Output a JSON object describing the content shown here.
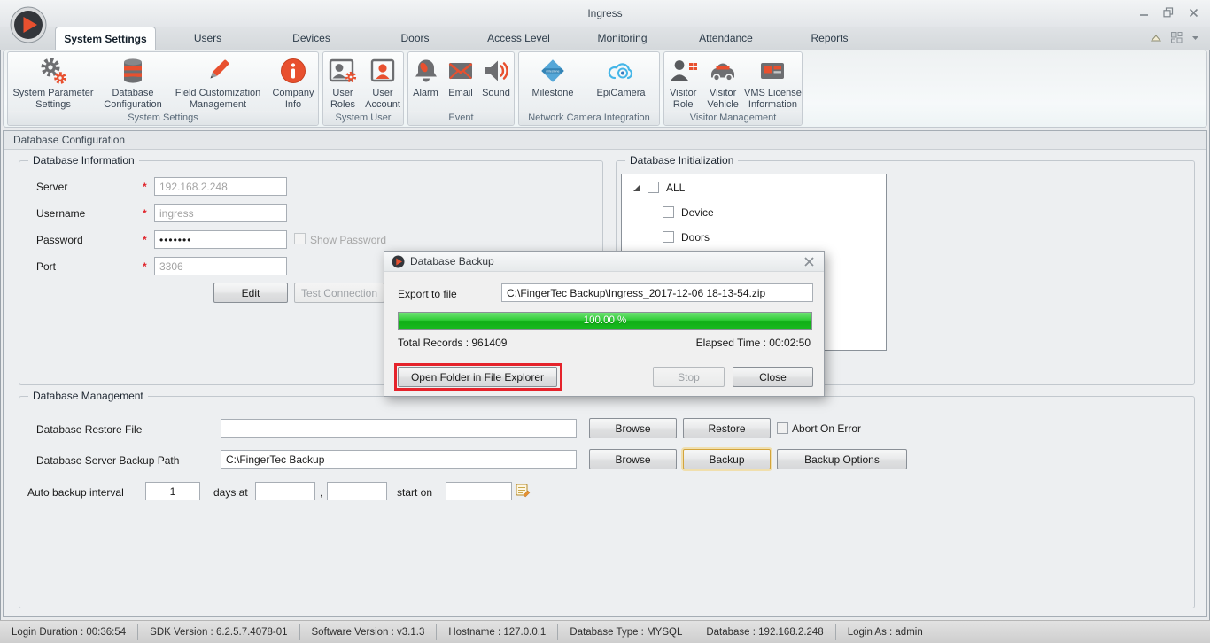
{
  "window": {
    "title": "Ingress"
  },
  "icons": {
    "app_logo": "play-circle",
    "minimize": "minimize-line",
    "restore": "restore-squares",
    "close": "✕",
    "ribbon_collapse": "chevron-up",
    "layout_switch": "grid-squares",
    "more": "caret-down",
    "tree_expander": "expanded-triangle",
    "date_picker": "calendar-edit"
  },
  "tabs": [
    {
      "label": "System Settings",
      "active": true
    },
    {
      "label": "Users",
      "active": false
    },
    {
      "label": "Devices",
      "active": false
    },
    {
      "label": "Doors",
      "active": false
    },
    {
      "label": "Access Level",
      "active": false
    },
    {
      "label": "Monitoring",
      "active": false
    },
    {
      "label": "Attendance",
      "active": false
    },
    {
      "label": "Reports",
      "active": false
    }
  ],
  "ribbon_groups": [
    {
      "caption": "System Settings",
      "items": [
        {
          "label": "System Parameter Settings",
          "icon": "gears-icon"
        },
        {
          "label": "Database Configuration",
          "icon": "database-icon"
        },
        {
          "label": "Field Customization Management",
          "icon": "pencil-icon"
        },
        {
          "label": "Company Info",
          "icon": "info-icon"
        }
      ]
    },
    {
      "caption": "System User",
      "items": [
        {
          "label": "User Roles",
          "icon": "user-roles-icon"
        },
        {
          "label": "User Account",
          "icon": "user-account-icon"
        }
      ]
    },
    {
      "caption": "Event",
      "items": [
        {
          "label": "Alarm",
          "icon": "bell-icon"
        },
        {
          "label": "Email",
          "icon": "envelope-icon"
        },
        {
          "label": "Sound",
          "icon": "speaker-icon"
        }
      ]
    },
    {
      "caption": "Network Camera Integration",
      "items": [
        {
          "label": "Milestone",
          "icon": "milestone-icon"
        },
        {
          "label": "EpiCamera",
          "icon": "epicamera-icon"
        }
      ]
    },
    {
      "caption": "Visitor Management",
      "items": [
        {
          "label": "Visitor Role",
          "icon": "visitor-role-icon"
        },
        {
          "label": "Visitor Vehicle",
          "icon": "car-icon"
        },
        {
          "label": "VMS License Information",
          "icon": "license-card-icon"
        }
      ]
    }
  ],
  "page": {
    "section_title": "Database Configuration"
  },
  "database_information": {
    "legend": "Database Information",
    "required_marker": "*",
    "fields": [
      {
        "label": "Server",
        "value": "192.168.2.248",
        "disabled": true
      },
      {
        "label": "Username",
        "value": "ingress",
        "disabled": true
      },
      {
        "label": "Password",
        "value": "•••••••",
        "disabled": false
      },
      {
        "label": "Port",
        "value": "3306",
        "disabled": true
      }
    ],
    "show_password_label": "Show Password",
    "edit_button": "Edit",
    "test_connection_button": "Test Connection"
  },
  "database_initialization": {
    "legend": "Database Initialization",
    "tree": {
      "root": "ALL",
      "children": [
        "Device",
        "Doors"
      ]
    }
  },
  "backup_dialog": {
    "title": "Database Backup",
    "export_label": "Export to file",
    "export_path": "C:\\FingerTec Backup\\Ingress_2017-12-06 18-13-54.zip",
    "progress_text": "100.00 %",
    "total_records": "Total Records : 961409",
    "elapsed_time": "Elapsed Time : 00:02:50",
    "open_folder_button": "Open Folder in File Explorer",
    "stop_button": "Stop",
    "close_button": "Close"
  },
  "database_management": {
    "legend": "Database Management",
    "restore_label": "Database Restore File",
    "restore_value": "",
    "backup_path_label": "Database Server Backup Path",
    "backup_path_value": "C:\\FingerTec Backup",
    "browse_button": "Browse",
    "restore_button": "Restore",
    "abort_on_error_label": "Abort On Error",
    "backup_button": "Backup",
    "backup_options_button": "Backup Options",
    "auto_backup_label": "Auto backup interval",
    "interval_value": "1",
    "days_at_label": "days at",
    "comma": ",",
    "time1": "",
    "time2": "",
    "start_on_label": "start on",
    "start_date": ""
  },
  "status_bar": {
    "items": [
      "Login Duration : 00:36:54",
      "SDK Version : 6.2.5.7.4078-01",
      "Software Version : v3.1.3",
      "Hostname : 127.0.0.1",
      "Database Type : MYSQL",
      "Database : 192.168.2.248",
      "Login As : admin"
    ]
  },
  "colors": {
    "accent_orange": "#e8502f",
    "icon_gray": "#6d6e71",
    "progress_green": "#17b51d",
    "annotation_red": "#e5232b",
    "milestone_blue": "#55a7d8",
    "epicamera_blue": "#45b6e8"
  }
}
